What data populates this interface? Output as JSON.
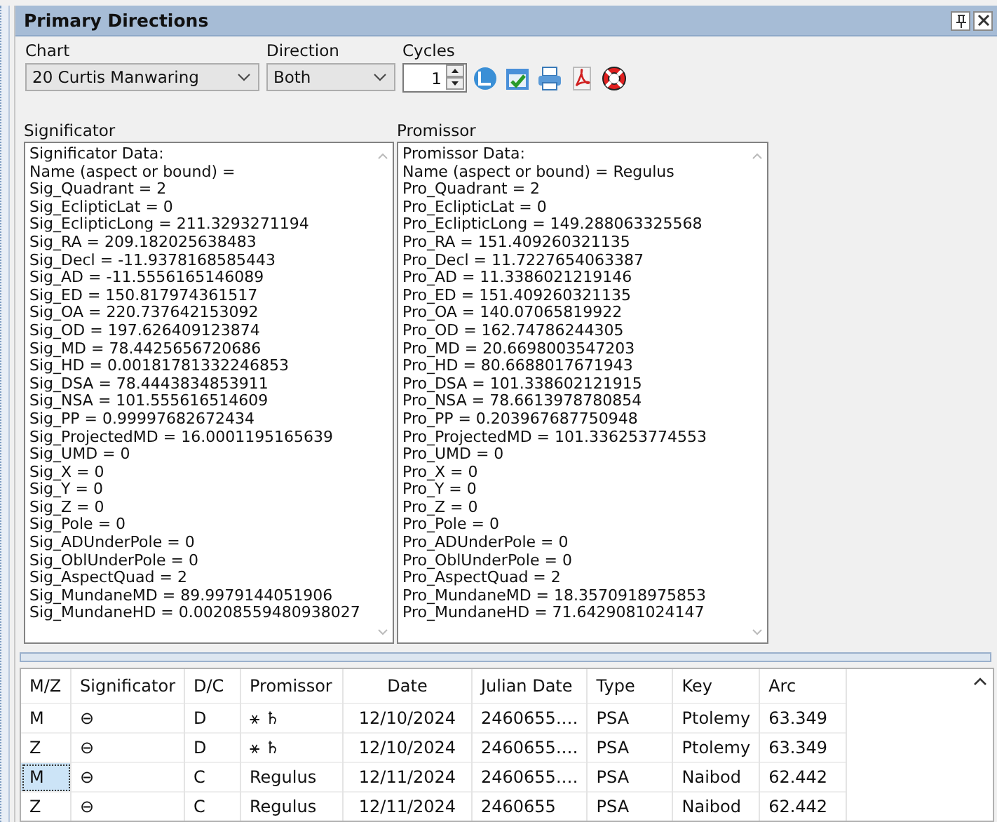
{
  "window": {
    "title": "Primary Directions"
  },
  "toolbar": {
    "chart": {
      "label": "Chart",
      "value": "20 Curtis Manwaring"
    },
    "direction": {
      "label": "Direction",
      "value": "Both"
    },
    "cycles": {
      "label": "Cycles",
      "value": "1"
    }
  },
  "significator": {
    "label": "Significator",
    "lines": [
      "Significator Data:",
      "Name (aspect or bound) =",
      "Sig_Quadrant = 2",
      "Sig_EclipticLat = 0",
      "Sig_EclipticLong = 211.3293271194",
      "Sig_RA = 209.182025638483",
      "Sig_Decl = -11.9378168585443",
      "Sig_AD = -11.5556165146089",
      "Sig_ED = 150.817974361517",
      "Sig_OA = 220.737642153092",
      "Sig_OD = 197.626409123874",
      "Sig_MD = 78.4425656720686",
      "Sig_HD = 0.00181781332246853",
      "Sig_DSA = 78.4443834853911",
      "Sig_NSA = 101.555616514609",
      "Sig_PP = 0.99997682672434",
      "Sig_ProjectedMD = 16.0001195165639",
      "Sig_UMD = 0",
      "Sig_X = 0",
      "Sig_Y = 0",
      "Sig_Z = 0",
      "Sig_Pole = 0",
      "Sig_ADUnderPole = 0",
      "Sig_OblUnderPole = 0",
      "Sig_AspectQuad = 2",
      "Sig_MundaneMD = 89.9979144051906",
      "Sig_MundaneHD = 0.00208559480938027"
    ]
  },
  "promissor": {
    "label": "Promissor",
    "lines": [
      "Promissor Data:",
      "Name (aspect or bound) = Regulus",
      "Pro_Quadrant = 2",
      "Pro_EclipticLat = 0",
      "Pro_EclipticLong = 149.288063325568",
      "Pro_RA = 151.409260321135",
      "Pro_Decl = 11.7227654063387",
      "Pro_AD = 11.3386021219146",
      "Pro_ED = 151.409260321135",
      "Pro_OA = 140.07065819922",
      "Pro_OD = 162.74786244305",
      "Pro_MD = 20.6698003547203",
      "Pro_HD = 80.6688017671943",
      "Pro_DSA = 101.338602121915",
      "Pro_NSA = 78.6613978780854",
      "Pro_PP = 0.203967687750948",
      "Pro_ProjectedMD = 101.336253774553",
      "Pro_UMD = 0",
      "Pro_X = 0",
      "Pro_Y = 0",
      "Pro_Z = 0",
      "Pro_Pole = 0",
      "Pro_ADUnderPole = 0",
      "Pro_OblUnderPole = 0",
      "Pro_AspectQuad = 2",
      "Pro_MundaneMD = 18.3570918975853",
      "Pro_MundaneHD = 71.6429081024147"
    ]
  },
  "table": {
    "columns": [
      "M/Z",
      "Significator",
      "D/C",
      "Promissor",
      "Date",
      "Julian Date",
      "Type",
      "Key",
      "Arc"
    ],
    "rows": [
      {
        "cells": [
          "M",
          "⊖",
          "D",
          "⚹ ♄",
          "12/10/2024",
          "2460655.…",
          "PSA",
          "Ptolemy",
          "63.349"
        ],
        "selected": false
      },
      {
        "cells": [
          "Z",
          "⊖",
          "D",
          "⚹ ♄",
          "12/10/2024",
          "2460655.…",
          "PSA",
          "Ptolemy",
          "63.349"
        ],
        "selected": false
      },
      {
        "cells": [
          "M",
          "⊖",
          "C",
          "Regulus",
          "12/11/2024",
          "2460655.…",
          "PSA",
          "Naibod",
          "62.442"
        ],
        "selected": true
      },
      {
        "cells": [
          "Z",
          "⊖",
          "C",
          "Regulus",
          "12/11/2024",
          "2460655",
          "PSA",
          "Naibod",
          "62.442"
        ],
        "selected": false
      }
    ]
  }
}
